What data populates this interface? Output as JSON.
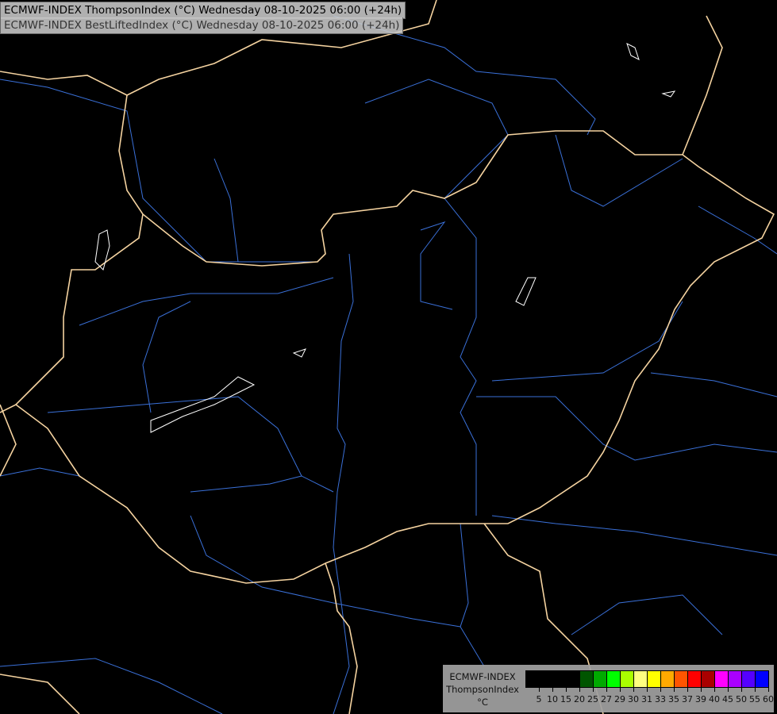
{
  "header": {
    "line1": "ECMWF-INDEX ThompsonIndex (°C) Wednesday 08-10-2025 06:00 (+24h)",
    "line2": "ECMWF-INDEX BestLiftedIndex (°C) Wednesday 08-10-2025 06:00 (+24h)"
  },
  "legend": {
    "model": "ECMWF-INDEX",
    "parameter": "ThompsonIndex",
    "unit": "°C",
    "colors": [
      "#000000",
      "#000000",
      "#000000",
      "#000000",
      "#005500",
      "#00aa00",
      "#00ff00",
      "#aaff00",
      "#ffff80",
      "#ffff00",
      "#ffaa00",
      "#ff5500",
      "#ff0000",
      "#aa0000",
      "#ff00ff",
      "#aa00ff",
      "#5500ff",
      "#0000ff"
    ],
    "labels": [
      "5",
      "10",
      "15",
      "20",
      "25",
      "27",
      "29",
      "30",
      "31",
      "33",
      "35",
      "37",
      "39",
      "40",
      "45",
      "50",
      "55",
      "60"
    ]
  },
  "map_colors": {
    "border": "#f5d3a0",
    "river": "#3a70d8",
    "lake": "#ffffff",
    "background": "#000000"
  }
}
